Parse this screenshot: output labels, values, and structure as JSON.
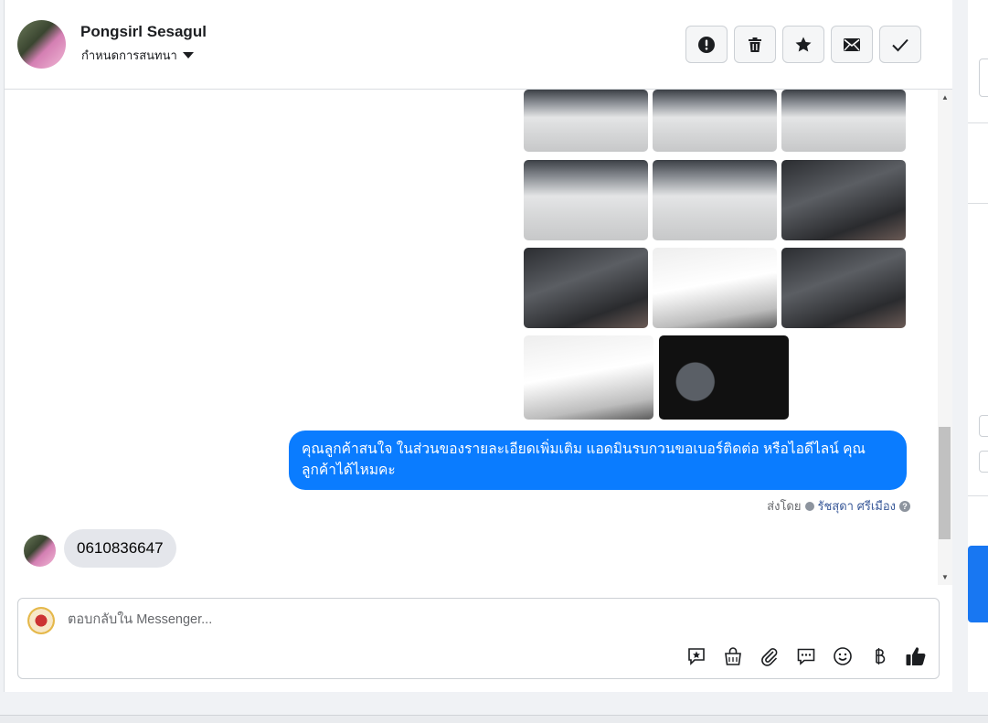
{
  "header": {
    "contact_name": "Pongsirl Sesagul",
    "conversation_label": "กำหนดการสนทนา",
    "actions": [
      {
        "name": "report-button",
        "icon": "exclamation-icon"
      },
      {
        "name": "delete-button",
        "icon": "trash-icon"
      },
      {
        "name": "star-button",
        "icon": "star-icon"
      },
      {
        "name": "mark-unread-button",
        "icon": "envelope-icon"
      },
      {
        "name": "done-button",
        "icon": "check-icon"
      }
    ]
  },
  "messages": {
    "outgoing_text": "คุณลูกค้าสนใจ ในส่วนของรายละเอียดเพิ่มเติม แอดมินรบกวนขอเบอร์ติดต่อ หรือไอดีไลน์ คุณลูกค้าได้ไหมคะ",
    "sent_by_label": "ส่งโดย",
    "sent_by_name": "รัชสุดา ศรีเมือง",
    "incoming_text": "0610836647"
  },
  "composer": {
    "placeholder": "ตอบกลับใน Messenger...",
    "tools": [
      "saved-reply-icon",
      "shopping-bag-icon",
      "paperclip-icon",
      "chat-bubble-icon",
      "emoji-icon",
      "baht-icon",
      "thumbs-up-icon"
    ]
  },
  "colors": {
    "outgoing_bubble": "#0a7cff",
    "incoming_bubble": "#e4e6eb",
    "accent": "#1877f2"
  }
}
